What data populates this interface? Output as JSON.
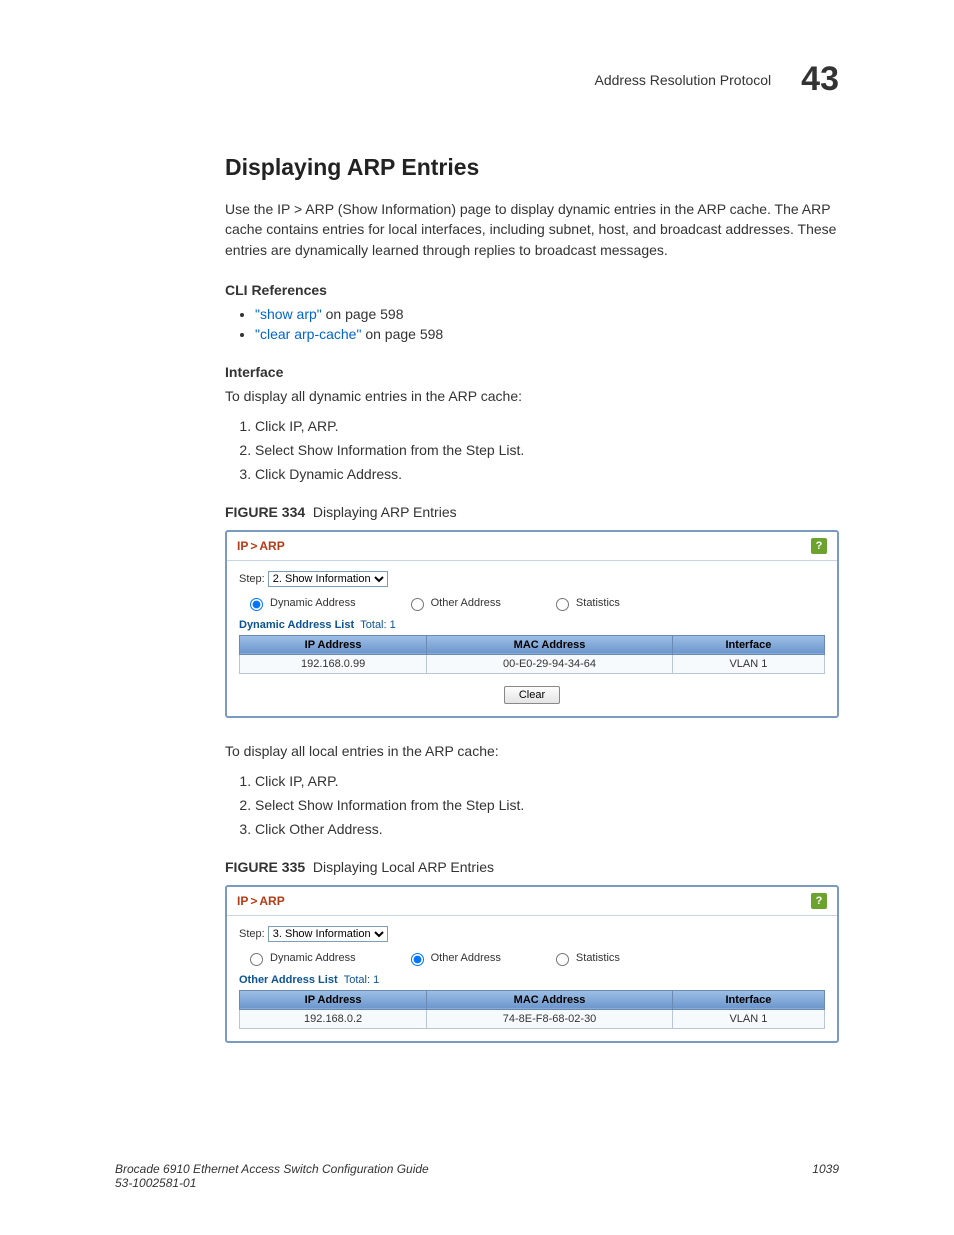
{
  "header": {
    "title": "Address Resolution Protocol",
    "chapter": "43"
  },
  "section": {
    "title": "Displaying ARP Entries",
    "intro": "Use the IP > ARP (Show Information) page to display dynamic entries in the ARP cache. The ARP cache contains entries for local interfaces, including subnet, host, and broadcast addresses. These entries are dynamically learned through replies to broadcast messages."
  },
  "cli": {
    "heading": "CLI References",
    "items": [
      {
        "link": "\"show arp\"",
        "rest": " on page 598"
      },
      {
        "link": "\"clear arp-cache\"",
        "rest": " on page 598"
      }
    ]
  },
  "iface1": {
    "heading": "Interface",
    "lead": "To display all dynamic entries in the ARP cache:",
    "steps": [
      "Click IP, ARP.",
      "Select Show Information from the Step List.",
      "Click Dynamic Address."
    ]
  },
  "fig334": {
    "label": "FIGURE 334",
    "caption": "Displaying ARP Entries",
    "breadcrumb": [
      "IP",
      "ARP"
    ],
    "stepLabel": "Step:",
    "stepSelected": "2. Show Information",
    "radios": {
      "dynamic": "Dynamic Address",
      "other": "Other Address",
      "stats": "Statistics",
      "selected": "dynamic"
    },
    "listTitle": "Dynamic Address List",
    "totalLabel": "Total:",
    "totalValue": "1",
    "columns": [
      "IP Address",
      "MAC Address",
      "Interface"
    ],
    "rows": [
      [
        "192.168.0.99",
        "00-E0-29-94-34-64",
        "VLAN 1"
      ]
    ],
    "clearBtn": "Clear"
  },
  "iface2": {
    "lead": "To display all local entries in the ARP cache:",
    "steps": [
      "Click IP, ARP.",
      "Select Show Information from the Step List.",
      "Click Other Address."
    ]
  },
  "fig335": {
    "label": "FIGURE 335",
    "caption": "Displaying Local ARP Entries",
    "breadcrumb": [
      "IP",
      "ARP"
    ],
    "stepLabel": "Step:",
    "stepSelected": "3. Show Information",
    "radios": {
      "dynamic": "Dynamic Address",
      "other": "Other Address",
      "stats": "Statistics",
      "selected": "other"
    },
    "listTitle": "Other Address List",
    "totalLabel": "Total:",
    "totalValue": "1",
    "columns": [
      "IP Address",
      "MAC Address",
      "Interface"
    ],
    "rows": [
      [
        "192.168.0.2",
        "74-8E-F8-68-02-30",
        "VLAN 1"
      ]
    ]
  },
  "footer": {
    "left1": "Brocade 6910 Ethernet Access Switch Configuration Guide",
    "left2": "53-1002581-01",
    "right": "1039"
  }
}
